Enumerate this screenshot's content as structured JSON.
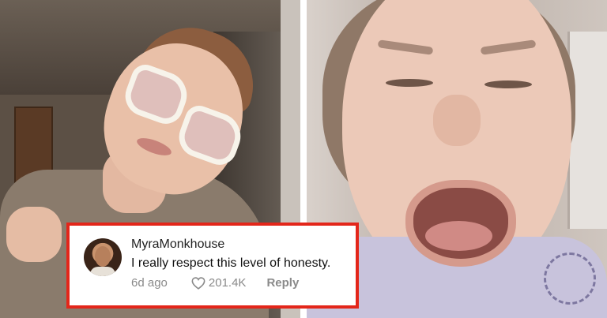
{
  "comment": {
    "username": "MyraMonkhouse",
    "text": "I really respect this level of honesty.",
    "timestamp": "6d ago",
    "like_count": "201.4K",
    "reply_label": "Reply",
    "like_icon": "heart-outline-icon",
    "border_color": "#e3261a"
  },
  "photos": {
    "left": "selfie-with-white-cat-eye-glasses",
    "right": "woman-mouth-open-grimacing"
  }
}
